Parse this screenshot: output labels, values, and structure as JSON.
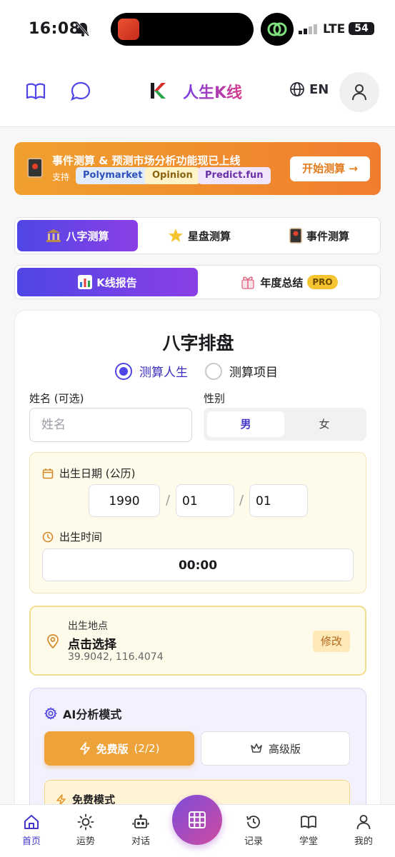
{
  "status_bar": {
    "time": "16:08",
    "network": "LTE",
    "battery": "54"
  },
  "header": {
    "title": "人生K线",
    "language": "EN"
  },
  "banner": {
    "title": "事件测算 & 预测市场分析功能现已上线",
    "support_label": "支持",
    "chips": [
      "Polymarket",
      "Opinion",
      "Predict.fun"
    ],
    "button": "开始测算 →"
  },
  "tabs_row1": [
    {
      "label": "八字测算",
      "active": true
    },
    {
      "label": "星盘测算",
      "active": false
    },
    {
      "label": "事件测算",
      "active": false
    }
  ],
  "tabs_row2": [
    {
      "label": "K线报告",
      "active": true
    },
    {
      "label": "年度总结",
      "badge": "PRO",
      "active": false
    }
  ],
  "form": {
    "title": "八字排盘",
    "mode_options": [
      "测算人生",
      "测算项目"
    ],
    "mode_selected": "测算人生",
    "name_label": "姓名 (可选)",
    "name_placeholder": "姓名",
    "gender_label": "性别",
    "gender_options": [
      "男",
      "女"
    ],
    "gender_selected": "男",
    "birth_date_label": "出生日期 (公历)",
    "birth_year": "1990",
    "birth_month": "01",
    "birth_day": "01",
    "date_separator": "/",
    "birth_time_label": "出生时间",
    "birth_time": "00:00",
    "place_label": "出生地点",
    "place_value": "点击选择",
    "place_coords": "39.9042, 116.4074",
    "place_edit": "修改",
    "ai_mode_label": "AI分析模式",
    "free_button": "免费版",
    "free_count": "(2/2)",
    "pro_button": "高级版",
    "free_mode_label": "免费模式"
  },
  "bottom_nav": [
    {
      "label": "首页",
      "icon": "home-icon",
      "active": true
    },
    {
      "label": "运势",
      "icon": "sun-icon"
    },
    {
      "label": "对话",
      "icon": "robot-icon"
    },
    {
      "label": "记录",
      "icon": "history-icon"
    },
    {
      "label": "学堂",
      "icon": "book-icon"
    },
    {
      "label": "我的",
      "icon": "user-icon"
    }
  ],
  "colors": {
    "accent": "#4f46e5",
    "orange": "#eda23a",
    "brand_gradient": "#7b3fe4"
  }
}
